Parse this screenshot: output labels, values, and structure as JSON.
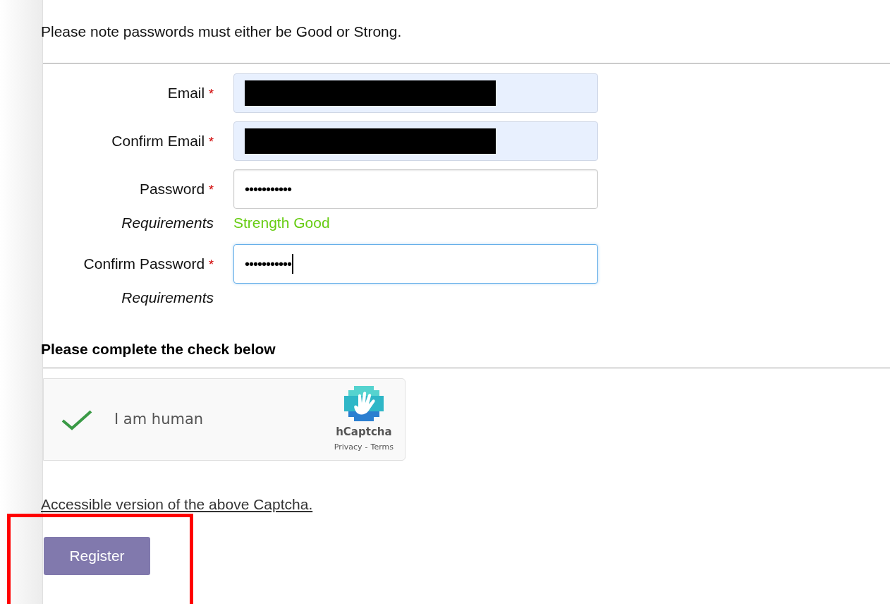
{
  "notice": "Please note passwords must either be Good or Strong.",
  "fields": [
    {
      "label": "Email",
      "required": true,
      "kind": "redacted",
      "autofilled": true,
      "focused": false
    },
    {
      "label": "Confirm Email",
      "required": true,
      "kind": "redacted",
      "autofilled": true,
      "focused": false
    },
    {
      "label": "Password",
      "required": true,
      "kind": "password",
      "value": "•••••••••••",
      "autofilled": false,
      "focused": false,
      "hint_label": "Requirements",
      "strength": "Strength Good"
    },
    {
      "label": "Confirm Password",
      "required": true,
      "kind": "password",
      "value": "•••••••••••",
      "autofilled": false,
      "focused": true,
      "hint_label": "Requirements"
    }
  ],
  "required_mark": "*",
  "check_heading": "Please complete the check below",
  "captcha": {
    "checked": true,
    "label": "I am human",
    "brand": "hCaptcha",
    "privacy": "Privacy",
    "separator": "-",
    "terms": "Terms"
  },
  "accessible_link": "Accessible version of the above Captcha.",
  "submit": "Register"
}
